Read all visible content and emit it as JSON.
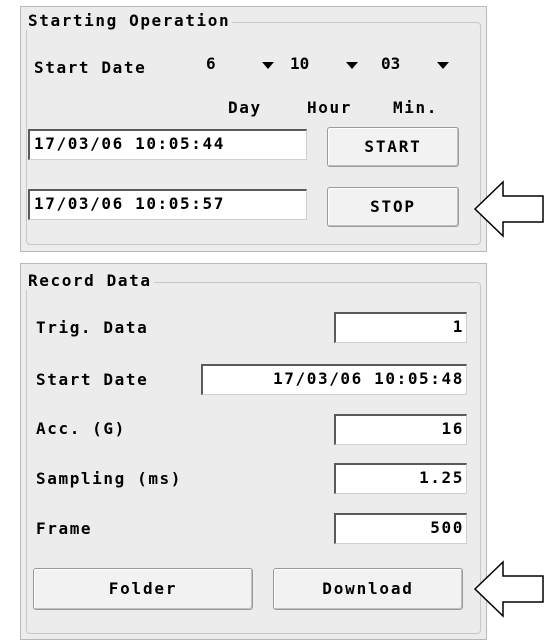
{
  "starting_operation": {
    "title": "Starting Operation",
    "start_date_label": "Start Date",
    "day_value": "6",
    "hour_value": "10",
    "min_value": "03",
    "day_label": "Day",
    "hour_label": "Hour",
    "min_label": "Min.",
    "start_time_value": "17/03/06 10:05:44",
    "stop_time_value": "17/03/06 10:05:57",
    "start_button_label": "START",
    "stop_button_label": "STOP"
  },
  "record_data": {
    "title": "Record Data",
    "trig_data_label": "Trig. Data",
    "trig_data_value": "1",
    "start_date_label": "Start Date",
    "start_date_value": "17/03/06 10:05:48",
    "acc_label": "Acc. (G)",
    "acc_value": "16",
    "sampling_label": "Sampling (ms)",
    "sampling_value": "1.25",
    "frame_label": "Frame",
    "frame_value": "500",
    "folder_button_label": "Folder",
    "download_button_label": "Download"
  },
  "icons": {
    "arrow_stop": "left-arrow-icon",
    "arrow_download": "left-arrow-icon",
    "dropdown": "chevron-down-icon"
  },
  "colors": {
    "panel_bg": "#ececec",
    "field_bg": "#ffffff",
    "text": "#000000"
  }
}
